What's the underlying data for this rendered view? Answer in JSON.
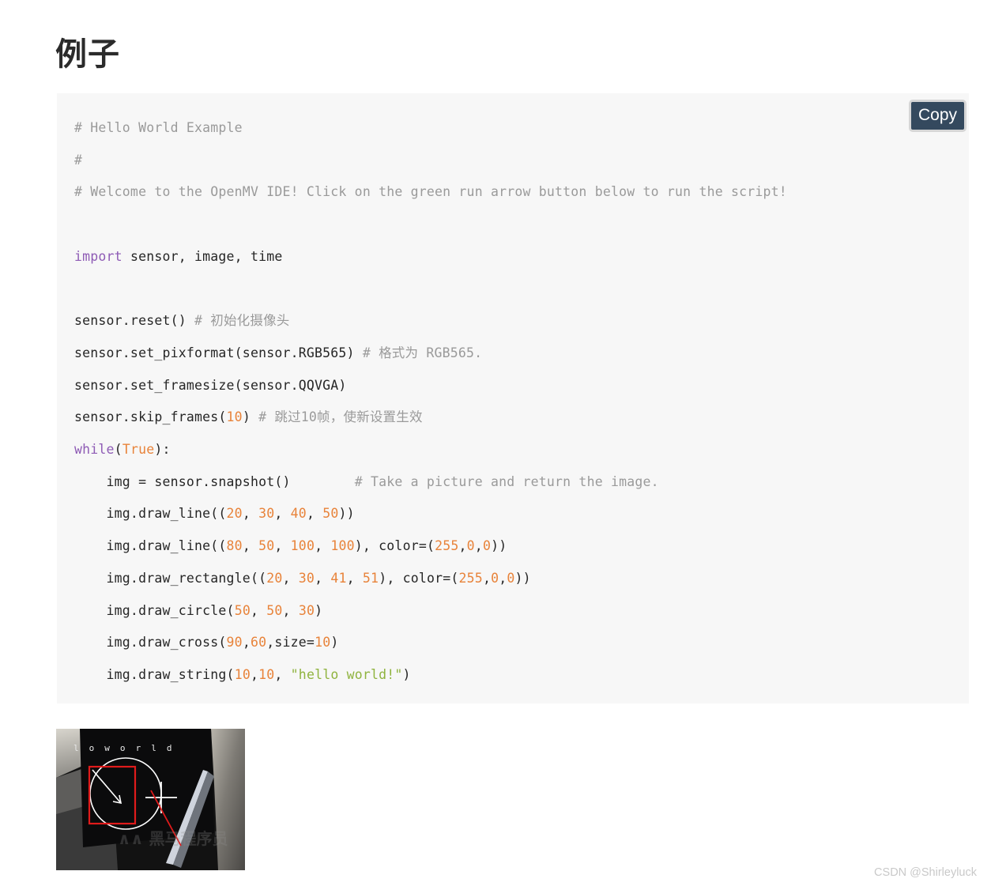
{
  "page": {
    "title": "例子",
    "background_color": "#ffffff"
  },
  "code_block": {
    "background_color": "#f7f7f7",
    "language": "python",
    "copy_button": {
      "label": "Copy",
      "background_color": "#34495e",
      "text_color": "#ffffff",
      "border_color": "#d6d6d6"
    },
    "syntax_colors": {
      "comment": "#9a9a9a",
      "keyword": "#8e5bb5",
      "number": "#e8833a",
      "string": "#8fb33e",
      "plain": "#262626"
    },
    "lines": [
      [
        {
          "t": "# Hello World Example",
          "c": "com"
        }
      ],
      [
        {
          "t": "#",
          "c": "com"
        }
      ],
      [
        {
          "t": "# Welcome to the OpenMV IDE! Click on the green run arrow button below to run the script!",
          "c": "com"
        }
      ],
      [],
      [
        {
          "t": "import",
          "c": "kw"
        },
        {
          "t": " sensor, image, time",
          "c": "plain"
        }
      ],
      [],
      [
        {
          "t": "sensor.reset() ",
          "c": "plain"
        },
        {
          "t": "# 初始化摄像头",
          "c": "com"
        }
      ],
      [
        {
          "t": "sensor.set_pixformat(sensor.RGB565) ",
          "c": "plain"
        },
        {
          "t": "# 格式为 RGB565.",
          "c": "com"
        }
      ],
      [
        {
          "t": "sensor.set_framesize(sensor.QQVGA)",
          "c": "plain"
        }
      ],
      [
        {
          "t": "sensor.skip_frames(",
          "c": "plain"
        },
        {
          "t": "10",
          "c": "num"
        },
        {
          "t": ") ",
          "c": "plain"
        },
        {
          "t": "# 跳过10帧，使新设置生效",
          "c": "com"
        }
      ],
      [
        {
          "t": "while",
          "c": "kw"
        },
        {
          "t": "(",
          "c": "plain"
        },
        {
          "t": "True",
          "c": "num"
        },
        {
          "t": "):",
          "c": "plain"
        }
      ],
      [
        {
          "t": "    img = sensor.snapshot()        ",
          "c": "plain"
        },
        {
          "t": "# Take a picture and return the image.",
          "c": "com"
        }
      ],
      [
        {
          "t": "    img.draw_line((",
          "c": "plain"
        },
        {
          "t": "20",
          "c": "num"
        },
        {
          "t": ", ",
          "c": "plain"
        },
        {
          "t": "30",
          "c": "num"
        },
        {
          "t": ", ",
          "c": "plain"
        },
        {
          "t": "40",
          "c": "num"
        },
        {
          "t": ", ",
          "c": "plain"
        },
        {
          "t": "50",
          "c": "num"
        },
        {
          "t": "))",
          "c": "plain"
        }
      ],
      [
        {
          "t": "    img.draw_line((",
          "c": "plain"
        },
        {
          "t": "80",
          "c": "num"
        },
        {
          "t": ", ",
          "c": "plain"
        },
        {
          "t": "50",
          "c": "num"
        },
        {
          "t": ", ",
          "c": "plain"
        },
        {
          "t": "100",
          "c": "num"
        },
        {
          "t": ", ",
          "c": "plain"
        },
        {
          "t": "100",
          "c": "num"
        },
        {
          "t": "), color=(",
          "c": "plain"
        },
        {
          "t": "255",
          "c": "num"
        },
        {
          "t": ",",
          "c": "plain"
        },
        {
          "t": "0",
          "c": "num"
        },
        {
          "t": ",",
          "c": "plain"
        },
        {
          "t": "0",
          "c": "num"
        },
        {
          "t": "))",
          "c": "plain"
        }
      ],
      [
        {
          "t": "    img.draw_rectangle((",
          "c": "plain"
        },
        {
          "t": "20",
          "c": "num"
        },
        {
          "t": ", ",
          "c": "plain"
        },
        {
          "t": "30",
          "c": "num"
        },
        {
          "t": ", ",
          "c": "plain"
        },
        {
          "t": "41",
          "c": "num"
        },
        {
          "t": ", ",
          "c": "plain"
        },
        {
          "t": "51",
          "c": "num"
        },
        {
          "t": "), color=(",
          "c": "plain"
        },
        {
          "t": "255",
          "c": "num"
        },
        {
          "t": ",",
          "c": "plain"
        },
        {
          "t": "0",
          "c": "num"
        },
        {
          "t": ",",
          "c": "plain"
        },
        {
          "t": "0",
          "c": "num"
        },
        {
          "t": "))",
          "c": "plain"
        }
      ],
      [
        {
          "t": "    img.draw_circle(",
          "c": "plain"
        },
        {
          "t": "50",
          "c": "num"
        },
        {
          "t": ", ",
          "c": "plain"
        },
        {
          "t": "50",
          "c": "num"
        },
        {
          "t": ", ",
          "c": "plain"
        },
        {
          "t": "30",
          "c": "num"
        },
        {
          "t": ")",
          "c": "plain"
        }
      ],
      [
        {
          "t": "    img.draw_cross(",
          "c": "plain"
        },
        {
          "t": "90",
          "c": "num"
        },
        {
          "t": ",",
          "c": "plain"
        },
        {
          "t": "60",
          "c": "num"
        },
        {
          "t": ",size=",
          "c": "plain"
        },
        {
          "t": "10",
          "c": "num"
        },
        {
          "t": ")",
          "c": "plain"
        }
      ],
      [
        {
          "t": "    img.draw_string(",
          "c": "plain"
        },
        {
          "t": "10",
          "c": "num"
        },
        {
          "t": ",",
          "c": "plain"
        },
        {
          "t": "10",
          "c": "num"
        },
        {
          "t": ", ",
          "c": "plain"
        },
        {
          "t": "\"hello world!\"",
          "c": "str"
        },
        {
          "t": ")",
          "c": "plain"
        }
      ]
    ]
  },
  "result_image": {
    "alt": "OpenMV camera frame showing drawn line, rectangle, circle, cross and hello world text",
    "overlay_text": "hello world!",
    "shapes": [
      {
        "name": "line",
        "color": "#ffffff"
      },
      {
        "name": "line-red",
        "color": "#e01b1b"
      },
      {
        "name": "rectangle",
        "color": "#e01b1b"
      },
      {
        "name": "circle",
        "color": "#ffffff"
      },
      {
        "name": "cross",
        "color": "#ffffff"
      }
    ]
  },
  "watermark": {
    "text": "CSDN @Shirleyluck"
  }
}
